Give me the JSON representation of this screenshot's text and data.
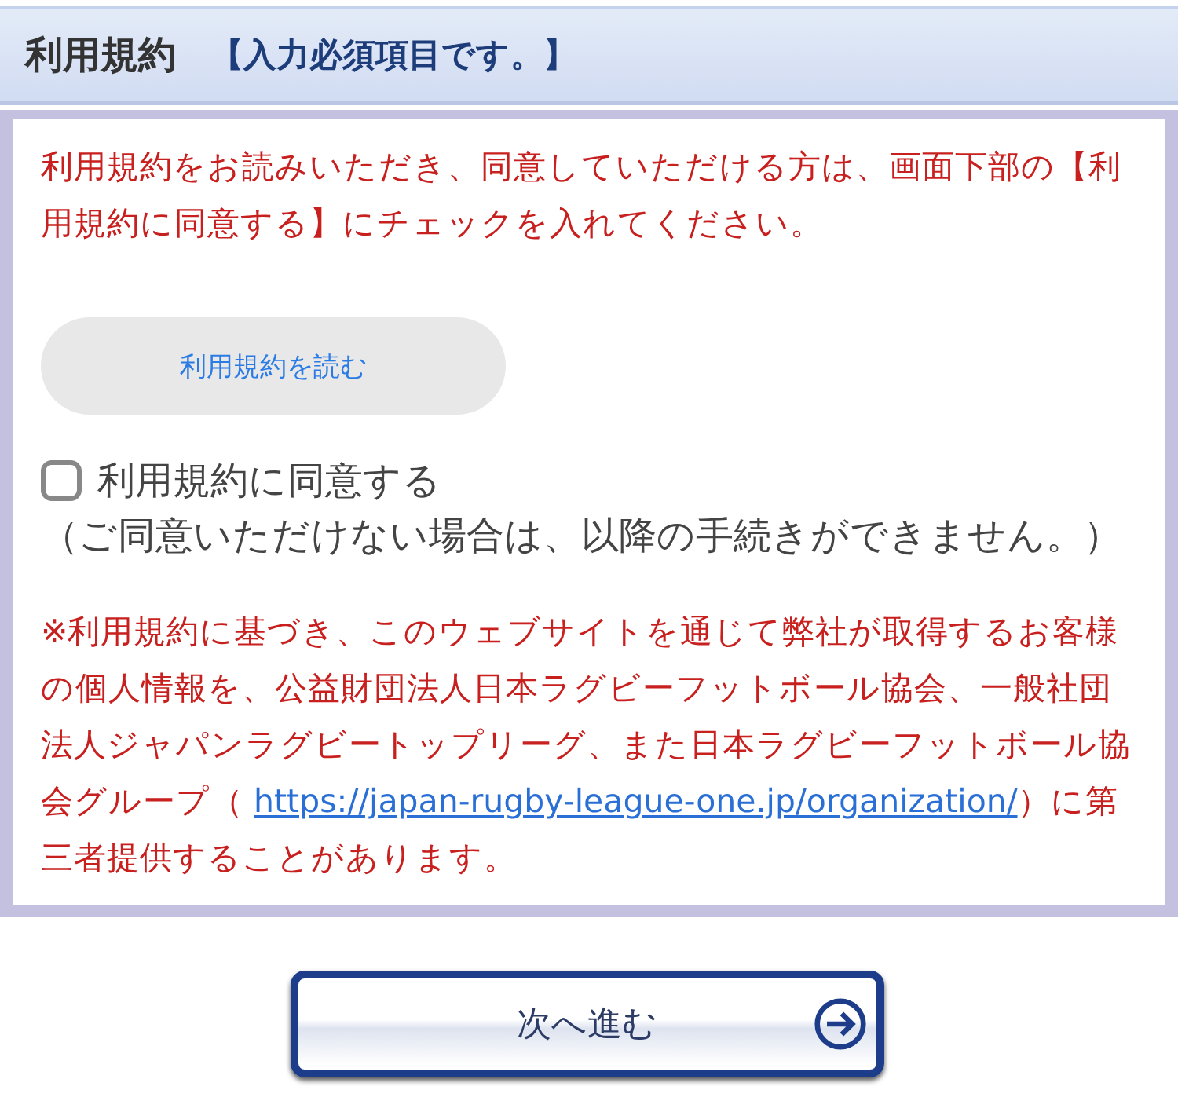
{
  "section": {
    "title": "利用規約",
    "required_note": "【入力必須項目です。】"
  },
  "intro": "利用規約をお読みいただき、同意していただける方は、画面下部の【利用規約に同意する】にチェックを入れてください。",
  "read_button": "利用規約を読む",
  "agree": {
    "label": "利用規約に同意する",
    "checked": false
  },
  "agree_note": "（ご同意いただけない場合は、以降の手続きができません。）",
  "notice": {
    "before": "※利用規約に基づき、このウェブサイトを通じて弊社が取得するお客様の個人情報を、公益財団法人日本ラグビーフットボール協会、一般社団法人ジャパンラグビートップリーグ、また日本ラグビーフットボール協会グループ（ ",
    "link": "https://japan-rugby-league-one.jp/organization/",
    "after": "）に第三者提供することがあります。"
  },
  "next_button": "次へ進む"
}
